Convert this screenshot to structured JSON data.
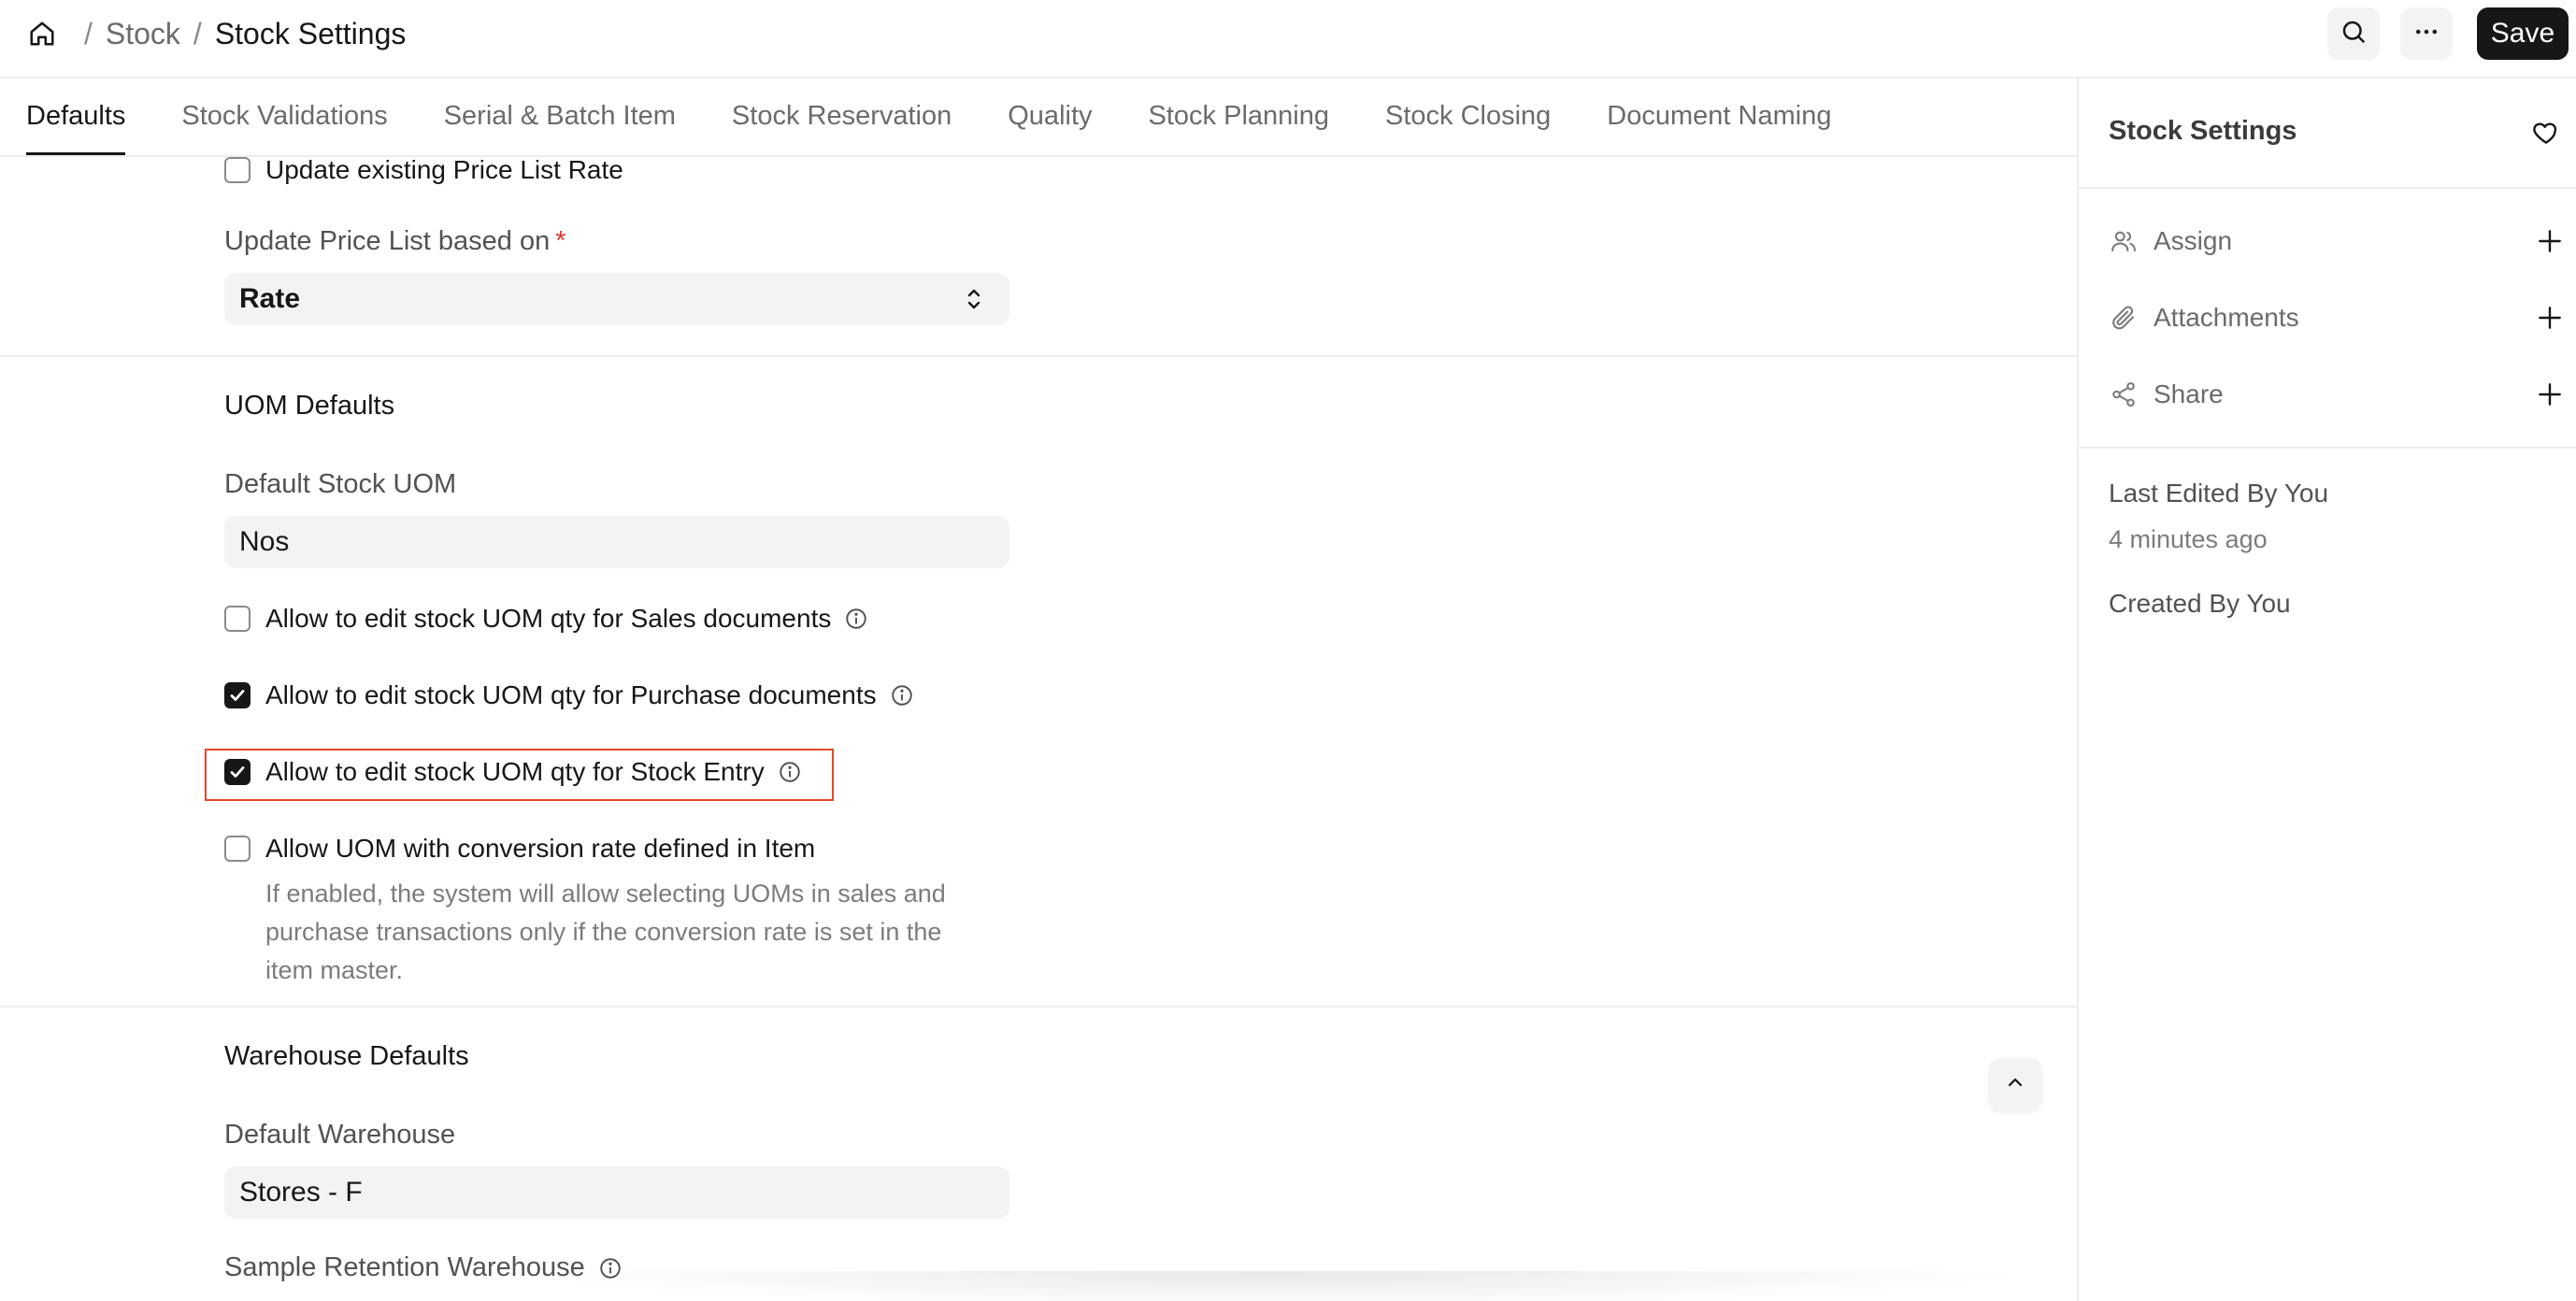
{
  "breadcrumb": {
    "stock": "Stock",
    "current": "Stock Settings",
    "separator": "/"
  },
  "toolbar": {
    "save_label": "Save",
    "search_icon": "search-icon",
    "more_icon": "more-horizontal-icon"
  },
  "tabs": [
    {
      "label": "Defaults",
      "active": true
    },
    {
      "label": "Stock Validations"
    },
    {
      "label": "Serial & Batch Item"
    },
    {
      "label": "Stock Reservation"
    },
    {
      "label": "Quality"
    },
    {
      "label": "Stock Planning"
    },
    {
      "label": "Stock Closing"
    },
    {
      "label": "Document Naming"
    }
  ],
  "form": {
    "update_existing_price": {
      "label": "Update existing Price List Rate",
      "checked": false
    },
    "price_list_based_on": {
      "label": "Update Price List based on",
      "required_mark": "*",
      "value": "Rate"
    },
    "uom_section": {
      "title": "UOM Defaults",
      "default_stock_uom": {
        "label": "Default Stock UOM",
        "value": "Nos"
      },
      "allow_sales": {
        "label": "Allow to edit stock UOM qty for Sales documents",
        "checked": false
      },
      "allow_purchase": {
        "label": "Allow to edit stock UOM qty for Purchase documents",
        "checked": true
      },
      "allow_stock_entry": {
        "label": "Allow to edit stock UOM qty for Stock Entry",
        "checked": true
      },
      "allow_uom_conversion": {
        "label": "Allow UOM with conversion rate defined in Item",
        "checked": false,
        "help": [
          "If enabled, the system will allow selecting UOMs in sales and",
          "purchase transactions only if the conversion rate is set in the",
          "item master."
        ]
      }
    },
    "warehouse_section": {
      "title": "Warehouse Defaults",
      "default_warehouse": {
        "label": "Default Warehouse",
        "value": "Stores - F"
      },
      "sample_retention": {
        "label": "Sample Retention Warehouse"
      }
    }
  },
  "sidebar": {
    "title": "Stock Settings",
    "assign": "Assign",
    "attachments": "Attachments",
    "share": "Share",
    "last_edited": "Last Edited By You",
    "last_edited_time": "4 minutes ago",
    "created": "Created By You"
  },
  "colors": {
    "accent": "#171717",
    "highlight": "#e24a2a",
    "required": "#e0332d"
  }
}
